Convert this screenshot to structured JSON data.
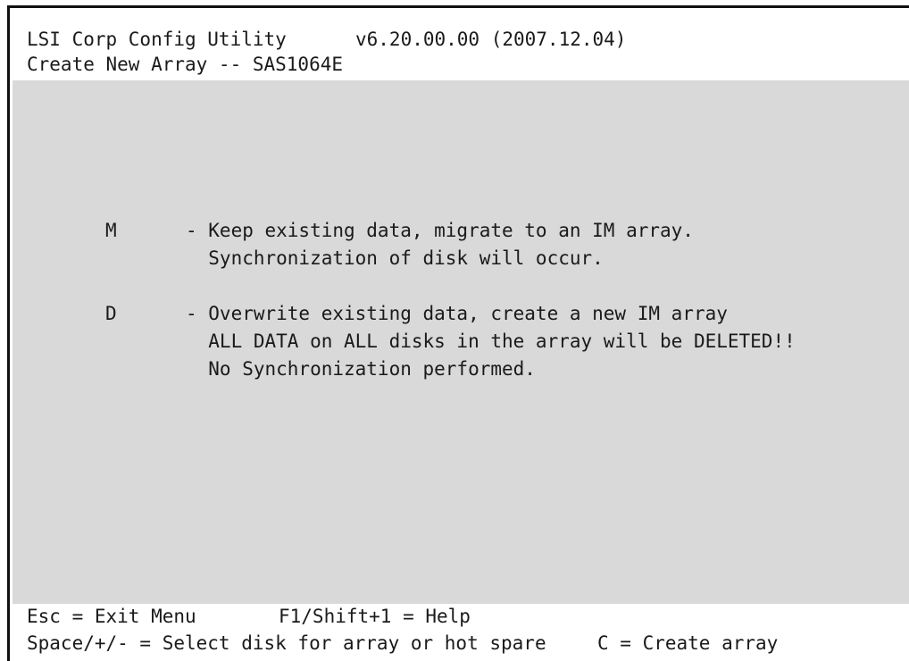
{
  "header": {
    "product": "LSI Corp Config Utility",
    "version": "v6.20.00.00 (2007.12.04)",
    "screen_title": "Create New Array -- SAS1064E"
  },
  "options": [
    {
      "key": "M",
      "lines": [
        "- Keep existing data, migrate to an IM array.",
        "  Synchronization of disk will occur."
      ]
    },
    {
      "key": "D",
      "lines": [
        "- Overwrite existing data, create a new IM array",
        "  ALL DATA on ALL disks in the array will be DELETED!!",
        "  No Synchronization performed."
      ]
    }
  ],
  "footer": {
    "line1_left": "Esc = Exit Menu",
    "line1_right": "F1/Shift+1 = Help",
    "line2_left": "Space/+/- = Select disk for array or hot spare",
    "line2_right": "C = Create array"
  }
}
